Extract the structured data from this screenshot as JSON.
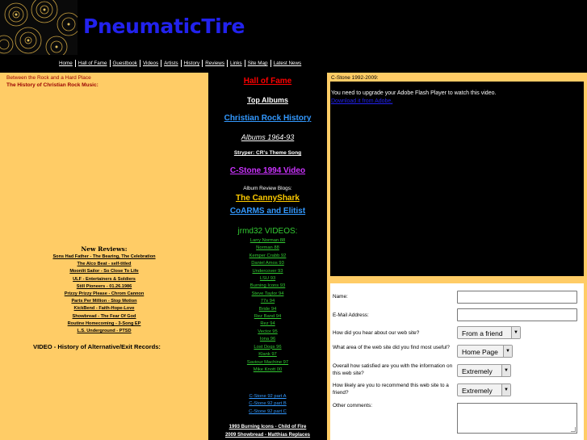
{
  "header": {
    "site_title": "PneumaticTire"
  },
  "nav": {
    "items": [
      "Home",
      "Hall of Fame",
      "Guestbook",
      "Videos",
      "Artists",
      "History",
      "Reviews",
      "Links",
      "Site Map",
      "Latest News"
    ]
  },
  "left": {
    "tagline": "Between the Rock and a Hard Place",
    "subtitle": "The History of Christian Rock Music:",
    "new_reviews_title": "New Reviews:",
    "reviews": [
      "Sons Had Father - The Bearing, The Celebration",
      "The Alco Beat - self-titled",
      "Moonlit Sailor - So Close To Life",
      "ULF - Entertainers & Soldiers",
      "Still Pioneers - 01.26.1986",
      "Prizzy Prizzy Please - Chrom Cannon",
      "Parts Per Million - Stop Motion",
      "KickBend - Faith-Hope-Love",
      "Showbread - The Fear Of God",
      "Routine Homecoming - 3-Song EP",
      "L.S. Underground - PTSD"
    ],
    "video_heading": "VIDEO - History of Alternative/Exit Records:"
  },
  "middle": {
    "hall_of_fame": "Hall of Fame",
    "top_albums": "Top Albums",
    "cr_history": "Christian Rock History",
    "albums_range": "Albums 1964-93",
    "stryper": "Stryper: CR's Theme Song",
    "cstone_1994": "C-Stone 1994 Video",
    "blogs_label": "Album Review Blogs:",
    "cannyshark": "The CannyShark",
    "coarms": "CoARMS and Elitist",
    "videos_heading": "jrmd32 VIDEOS:",
    "videos": [
      "Larry Norman 88",
      "Norman 88",
      "Kemper Crabb 92",
      "Daniel Amos 93",
      "Undercover 93",
      "LSU 93",
      "Burning Icons 93",
      "Steve Taylor 94",
      "77s 94",
      "Bride 94",
      "Rez Band 94",
      "Rez 94",
      "Vector 95",
      "Iona 96",
      "Lost Dogs 96",
      "Klank 97",
      "Saviour Machine 97",
      "Mike Knott 00"
    ],
    "cstone_parts": [
      "C-Stone 92 part A",
      "C-Stone 92 part B",
      "C-Stone 92 part C"
    ],
    "bottom_links": [
      "1993 Burning Icons - Child of Fire",
      "2009 Showbread - Matthias Replaces"
    ]
  },
  "right": {
    "caption": "C-Stone 1992-2009:",
    "player_message": "You need to upgrade your Adobe Flash Player to watch this video.",
    "player_link": "Download it from Adobe.",
    "form": {
      "name_label": "Name:",
      "email_label": "E-Mail Address:",
      "hear_label": "How did you hear about our web site?",
      "hear_value": "From a friend",
      "area_label": "What area of the web site did you find most useful?",
      "area_value": "Home Page",
      "satisfied_label": "Overall how satisfied are you with the information on this web site?",
      "satisfied_value": "Extremely",
      "recommend_label": "How likely are you to recommend this web site to a friend?",
      "recommend_value": "Extremely",
      "comments_label": "Other comments:"
    }
  },
  "colors": {
    "accent_blue": "#2222ee",
    "panel_orange": "#ffcc66",
    "hof_red": "#ff0000",
    "video_green": "#33cc33"
  }
}
